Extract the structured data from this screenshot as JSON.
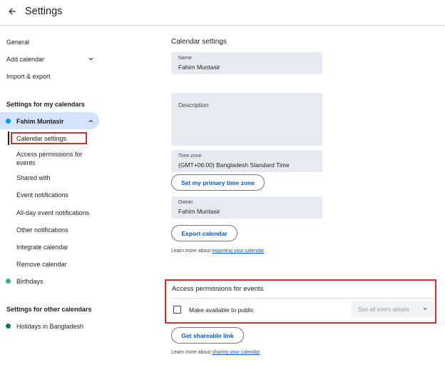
{
  "header": {
    "title": "Settings"
  },
  "sidebar": {
    "top_items": [
      "General",
      "Add calendar",
      "Import & export"
    ],
    "my_calendars_heading": "Settings for my calendars",
    "my_calendar": {
      "name": "Fahim Muntasir",
      "color": "#039be5"
    },
    "sub_items": [
      "Calendar settings",
      "Access permissions for",
      "events",
      "Shared with",
      "Event notifications",
      "All-day event notifications",
      "Other notifications",
      "Integrate calendar",
      "Remove calendar"
    ],
    "birthdays": {
      "name": "Birthdays",
      "color": "#33b679"
    },
    "other_calendars_heading": "Settings for other calendars",
    "holidays": {
      "name": "Holidays in Bangladesh",
      "color": "#0b8043"
    }
  },
  "main": {
    "section_title": "Calendar settings",
    "name_field": {
      "label": "Name",
      "value": "Fahim Muntasir"
    },
    "description_field": {
      "label": "Description",
      "value": ""
    },
    "timezone_field": {
      "label": "Time zone",
      "value": "(GMT+06:00) Bangladesh Standard Time"
    },
    "primary_tz_button": "Set my primary time zone",
    "owner_field": {
      "label": "Owner",
      "value": "Fahim Muntasir"
    },
    "export_button": "Export calendar",
    "export_help": {
      "prefix": "Learn more about ",
      "link": "exporting your calendar"
    },
    "access": {
      "title": "Access permissions for events",
      "checkbox_label": "Make available to public",
      "select_value": "See all event details"
    },
    "share_button": "Get shareable link",
    "share_help": {
      "prefix": "Learn more about ",
      "link": "sharing your calendar"
    }
  },
  "colors": {
    "highlight": "#d32f2f",
    "accent": "#0b57d0",
    "selected_bg": "#d3e3fd"
  }
}
